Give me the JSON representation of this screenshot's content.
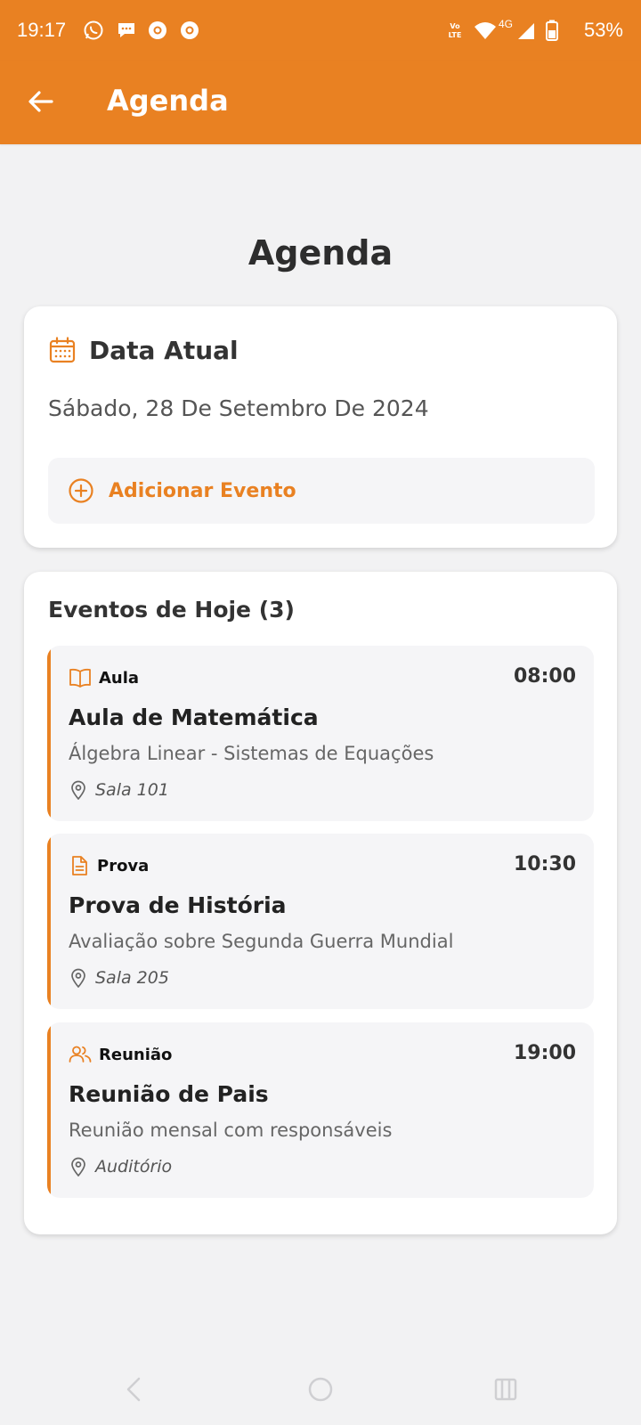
{
  "status_bar": {
    "time": "19:17",
    "battery": "53%",
    "app_icons": [
      "whatsapp-icon",
      "chat-icon",
      "chrome-icon",
      "chrome-icon"
    ],
    "network_label": "4G"
  },
  "app_bar": {
    "title": "Agenda"
  },
  "page": {
    "title": "Agenda"
  },
  "date_card": {
    "header": "Data Atual",
    "current_date": "Sábado, 28 De Setembro De 2024",
    "add_event_label": "Adicionar Evento"
  },
  "events_card": {
    "heading": "Eventos de Hoje (3)",
    "events": [
      {
        "type": "Aula",
        "type_icon": "book-icon",
        "time": "08:00",
        "title": "Aula de Matemática",
        "description": "Álgebra Linear - Sistemas de Equações",
        "location": "Sala 101"
      },
      {
        "type": "Prova",
        "type_icon": "document-icon",
        "time": "10:30",
        "title": "Prova de História",
        "description": "Avaliação sobre Segunda Guerra Mundial",
        "location": "Sala 205"
      },
      {
        "type": "Reunião",
        "type_icon": "people-icon",
        "time": "19:00",
        "title": "Reunião de Pais",
        "description": "Reunião mensal com responsáveis",
        "location": "Auditório"
      }
    ]
  },
  "colors": {
    "accent": "#e98122",
    "background": "#f2f2f3",
    "card": "#ffffff",
    "event_card": "#f5f5f7"
  }
}
